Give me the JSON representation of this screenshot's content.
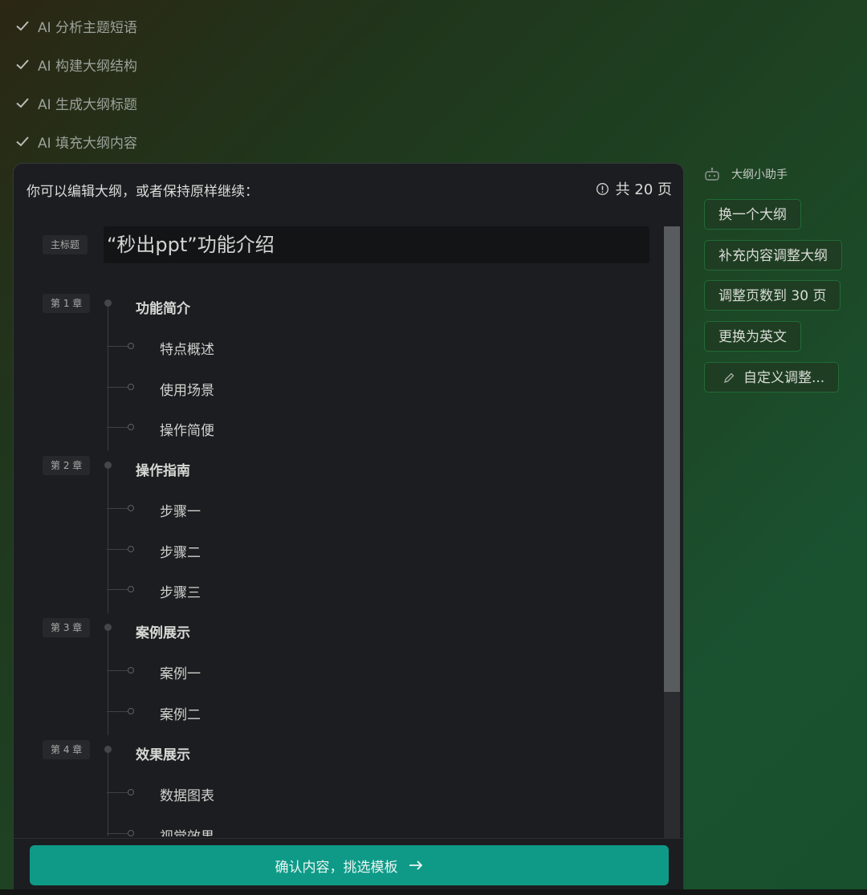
{
  "progress_steps": [
    {
      "label": "AI 分析主题短语",
      "icon": "check-icon"
    },
    {
      "label": "AI 构建大纲结构",
      "icon": "check-icon"
    },
    {
      "label": "AI 生成大纲标题",
      "icon": "check-icon"
    },
    {
      "label": "AI 填充大纲内容",
      "icon": "check-icon"
    }
  ],
  "panel": {
    "instruction": "你可以编辑大纲，或者保持原样继续：",
    "page_count_icon": "info-icon",
    "page_count": "共 20 页"
  },
  "outline": {
    "main_title_tag": "主标题",
    "main_title": "“秒出ppt”功能介绍",
    "chapters": [
      {
        "tag": "第 1 章",
        "title": "功能简介",
        "sections": [
          "特点概述",
          "使用场景",
          "操作简便"
        ]
      },
      {
        "tag": "第 2 章",
        "title": "操作指南",
        "sections": [
          "步骤一",
          "步骤二",
          "步骤三"
        ]
      },
      {
        "tag": "第 3 章",
        "title": "案例展示",
        "sections": [
          "案例一",
          "案例二"
        ]
      },
      {
        "tag": "第 4 章",
        "title": "效果展示",
        "sections": [
          "数据图表",
          "视觉效果"
        ]
      }
    ]
  },
  "confirm_button": {
    "label": "确认内容，挑选模板",
    "icon": "arrow-right-icon"
  },
  "assistant": {
    "title": "大纲小助手",
    "icon": "robot-icon",
    "suggestions": [
      "换一个大纲",
      "补充内容调整大纲",
      "调整页数到 30 页",
      "更换为英文"
    ],
    "custom_label": "自定义调整...",
    "custom_icon": "pencil-icon"
  },
  "colors": {
    "accent": "#0f9a88",
    "panel_bg": "#1b1d20",
    "suggestion_border": "#206b35"
  }
}
